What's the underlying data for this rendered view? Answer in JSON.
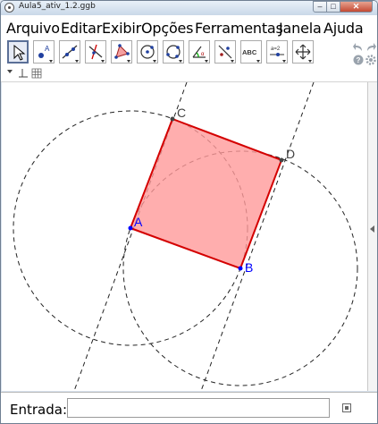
{
  "window": {
    "title": "Aula5_ativ_1.2.ggb",
    "minimize": "–",
    "maximize": "□",
    "close": "✕"
  },
  "menu": {
    "items": [
      "Arquivo",
      "Editar",
      "Exibir",
      "Opções",
      "Ferramentas",
      "Janela",
      "Ajuda"
    ]
  },
  "toolbar": {
    "tools": [
      {
        "name": "move-tool",
        "icon": "arrow-icon"
      },
      {
        "name": "point-tool",
        "icon": "point-icon"
      },
      {
        "name": "line-tool",
        "icon": "line-icon"
      },
      {
        "name": "perpendicular-tool",
        "icon": "perpendicular-line-icon"
      },
      {
        "name": "polygon-tool",
        "icon": "polygon-icon"
      },
      {
        "name": "circle-tool",
        "icon": "circle-center-point-icon"
      },
      {
        "name": "circle3-tool",
        "icon": "circle-three-points-icon"
      },
      {
        "name": "angle-tool",
        "icon": "angle-icon"
      },
      {
        "name": "reflect-tool",
        "icon": "reflect-line-icon"
      },
      {
        "name": "text-tool",
        "icon": "text-icon",
        "label": "ABC"
      },
      {
        "name": "slider-tool",
        "icon": "slider-icon",
        "label": "a=2"
      },
      {
        "name": "move-view-tool",
        "icon": "move-graphics-icon"
      }
    ]
  },
  "graphics": {
    "points": [
      {
        "label": "A",
        "color": "#0000ff"
      },
      {
        "label": "B",
        "color": "#0000ff"
      },
      {
        "label": "C",
        "color": "#444444"
      },
      {
        "label": "D",
        "color": "#444444"
      }
    ],
    "polygon_fill": "#ff9a9a",
    "polygon_stroke": "#d40000"
  },
  "input": {
    "label": "Entrada:",
    "value": "",
    "placeholder": ""
  }
}
